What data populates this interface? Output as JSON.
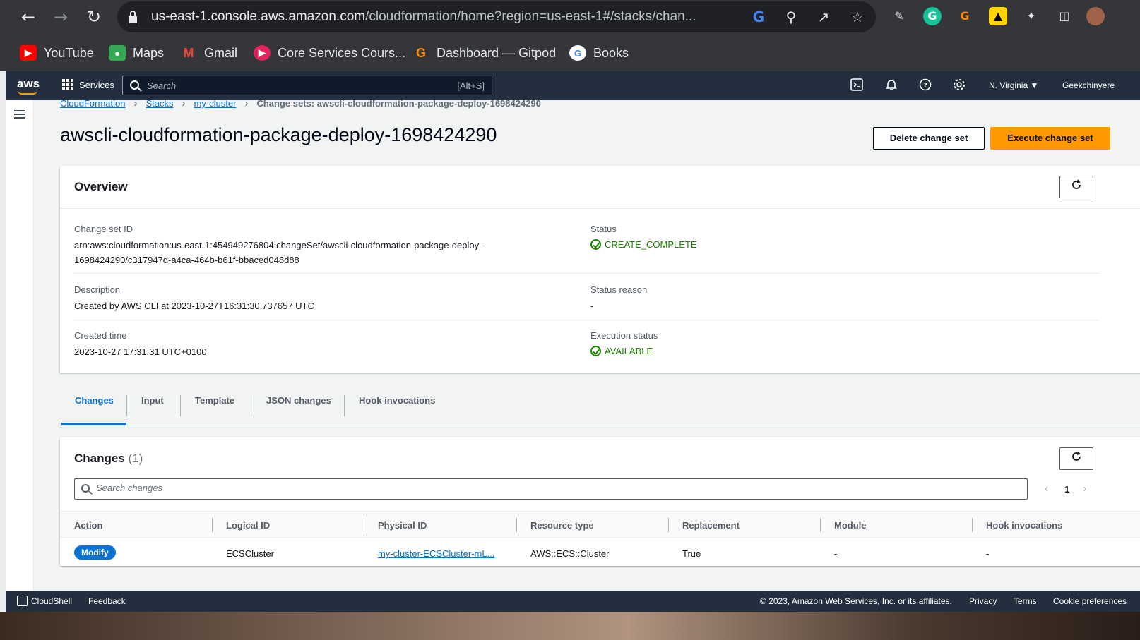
{
  "browser": {
    "url_host": "us-east-1.console.aws.amazon.com",
    "url_path": "/cloudformation/home?region=us-east-1#/stacks/chan...",
    "bookmarks": [
      {
        "label": "YouTube",
        "icon": "youtube-icon",
        "color": "#ff0000"
      },
      {
        "label": "Maps",
        "icon": "maps-icon",
        "color": "#34a853"
      },
      {
        "label": "Gmail",
        "icon": "gmail-icon",
        "color": "#ea4335"
      },
      {
        "label": "Core Services Cours...",
        "icon": "core-services-icon",
        "color": "#e0245e"
      },
      {
        "label": "Dashboard — Gitpod",
        "icon": "gitpod-icon",
        "color": "#ff8a00"
      },
      {
        "label": "Books",
        "icon": "google-icon",
        "color": "#4285f4"
      }
    ]
  },
  "aws_header": {
    "logo": "aws",
    "services_label": "Services",
    "search_placeholder": "Search",
    "search_shortcut": "[Alt+S]",
    "region": "N. Virginia ▼",
    "user": "Geekchinyere"
  },
  "breadcrumb": {
    "items": [
      "CloudFormation",
      "Stacks",
      "my-cluster"
    ],
    "current": "Change sets: awscli-cloudformation-package-deploy-1698424290"
  },
  "page": {
    "title": "awscli-cloudformation-package-deploy-1698424290",
    "delete_button": "Delete change set",
    "execute_button": "Execute change set"
  },
  "overview": {
    "title": "Overview",
    "change_set_id_label": "Change set ID",
    "change_set_id_line1": "arn:aws:cloudformation:us-east-1:454949276804:changeSet/awscli-cloudformation-package-deploy-",
    "change_set_id_line2": "1698424290/c317947d-a4ca-464b-b61f-bbaced048d88",
    "status_label": "Status",
    "status_value": "CREATE_COMPLETE",
    "description_label": "Description",
    "description_value": "Created by AWS CLI at 2023-10-27T16:31:30.737657 UTC",
    "status_reason_label": "Status reason",
    "status_reason_value": "-",
    "created_time_label": "Created time",
    "created_time_value": "2023-10-27 17:31:31 UTC+0100",
    "execution_status_label": "Execution status",
    "execution_status_value": "AVAILABLE"
  },
  "tabs": [
    "Changes",
    "Input",
    "Template",
    "JSON changes",
    "Hook invocations"
  ],
  "changes": {
    "title": "Changes",
    "count": "(1)",
    "search_placeholder": "Search changes",
    "page": "1",
    "columns": [
      "Action",
      "Logical ID",
      "Physical ID",
      "Resource type",
      "Replacement",
      "Module",
      "Hook invocations"
    ],
    "rows": [
      {
        "action": "Modify",
        "logical_id": "ECSCluster",
        "physical_id": "my-cluster-ECSCluster-mL...",
        "resource_type": "AWS::ECS::Cluster",
        "replacement": "True",
        "module": "-",
        "hook_invocations": "-"
      }
    ]
  },
  "footer": {
    "cloudshell": "CloudShell",
    "feedback": "Feedback",
    "copyright": "© 2023, Amazon Web Services, Inc. or its affiliates.",
    "privacy": "Privacy",
    "terms": "Terms",
    "cookies": "Cookie preferences"
  },
  "colors": {
    "accent": "#0972d3",
    "primary_button": "#ff9900",
    "success": "#1d8102",
    "header_bg": "#232f3e"
  }
}
